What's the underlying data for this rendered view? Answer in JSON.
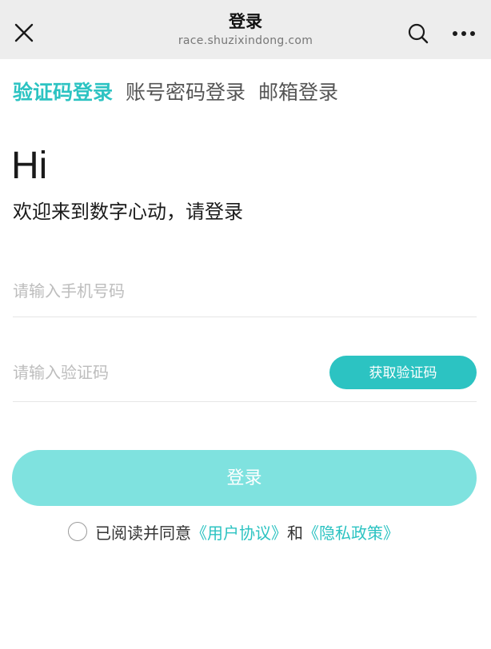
{
  "header": {
    "title": "登录",
    "url": "race.shuzixindong.com"
  },
  "tabs": [
    {
      "label": "验证码登录",
      "active": true
    },
    {
      "label": "账号密码登录",
      "active": false
    },
    {
      "label": "邮箱登录",
      "active": false
    }
  ],
  "greeting": {
    "hi": "Hi",
    "welcome": "欢迎来到数字心动，请登录"
  },
  "form": {
    "phone_placeholder": "请输入手机号码",
    "code_placeholder": "请输入验证码",
    "get_code_label": "获取验证码",
    "login_label": "登录"
  },
  "agreement": {
    "prefix": "已阅读并同意",
    "user_agreement": "《用户协议》",
    "and": "和",
    "privacy_policy": "《隐私政策》",
    "checked": false
  },
  "colors": {
    "accent": "#2cc3c2",
    "login_button": "#7fe2df",
    "topbar_bg": "#ededed"
  }
}
